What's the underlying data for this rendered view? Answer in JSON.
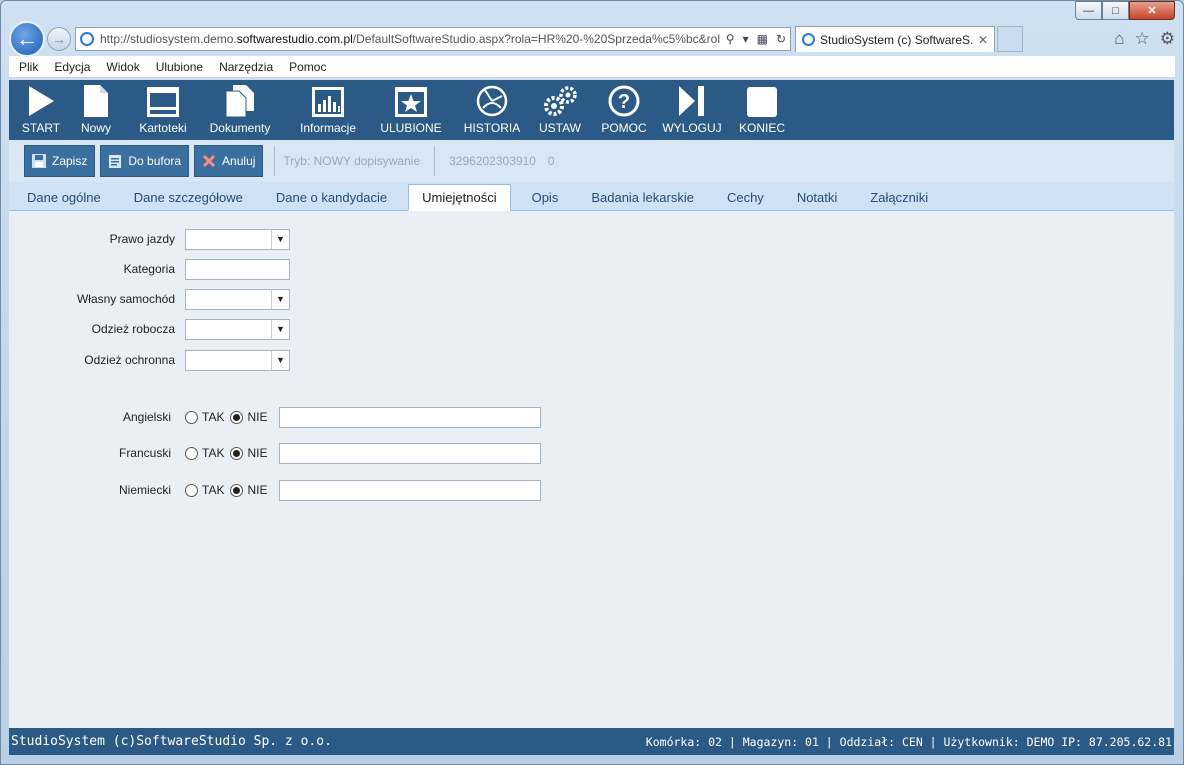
{
  "browser": {
    "url_prefix": "http://studiosystem.demo.",
    "url_domain": "softwarestudio.com.pl",
    "url_rest": "/DefaultSoftwareStudio.aspx?rola=HR%20-%20Sprzeda%c5%bc&rol",
    "tab_title": "StudioSystem (c) SoftwareS...",
    "menu": [
      "Plik",
      "Edycja",
      "Widok",
      "Ulubione",
      "Narzędzia",
      "Pomoc"
    ]
  },
  "toolbar": {
    "items": [
      {
        "label": "START",
        "icon": "play-icon"
      },
      {
        "label": "Nowy",
        "icon": "new-document-icon"
      },
      {
        "label": "Kartoteki",
        "icon": "cards-icon"
      },
      {
        "label": "Dokumenty",
        "icon": "documents-icon"
      },
      {
        "label": "Informacje",
        "icon": "chart-icon"
      },
      {
        "label": "ULUBIONE",
        "icon": "star-icon"
      },
      {
        "label": "HISTORIA",
        "icon": "history-icon"
      },
      {
        "label": "USTAW",
        "icon": "gears-icon"
      },
      {
        "label": "POMOC",
        "icon": "help-icon"
      },
      {
        "label": "WYLOGUJ",
        "icon": "logout-icon"
      },
      {
        "label": "KONIEC",
        "icon": "exit-icon"
      }
    ]
  },
  "actions": {
    "save": "Zapisz",
    "buffer": "Do bufora",
    "cancel": "Anuluj",
    "mode": "Tryb: NOWY dopisywanie",
    "record_id": "3296202303910",
    "record_extra": "0"
  },
  "tabs": [
    "Dane ogólne",
    "Dane szczegółowe",
    "Dane o kandydacie",
    "Umiejętności",
    "Opis",
    "Badania lekarskie",
    "Cechy",
    "Notatki",
    "Załączniki"
  ],
  "active_tab": "Umiejętności",
  "form": {
    "driving_license": "Prawo jazdy",
    "category": "Kategoria",
    "own_car": "Własny samochód",
    "work_clothes": "Odzież robocza",
    "protective_clothes": "Odzież ochronna"
  },
  "languages": {
    "yes": "TAK",
    "no": "NIE",
    "items": [
      {
        "label": "Angielski",
        "selected": "NIE"
      },
      {
        "label": "Francuski",
        "selected": "NIE"
      },
      {
        "label": "Niemiecki",
        "selected": "NIE"
      }
    ]
  },
  "status": {
    "left": "StudioSystem (c)SoftwareStudio Sp. z o.o.",
    "right": "Komórka: 02 | Magazyn: 01 | Oddział: CEN | Użytkownik: DEMO IP: 87.205.62.81"
  }
}
